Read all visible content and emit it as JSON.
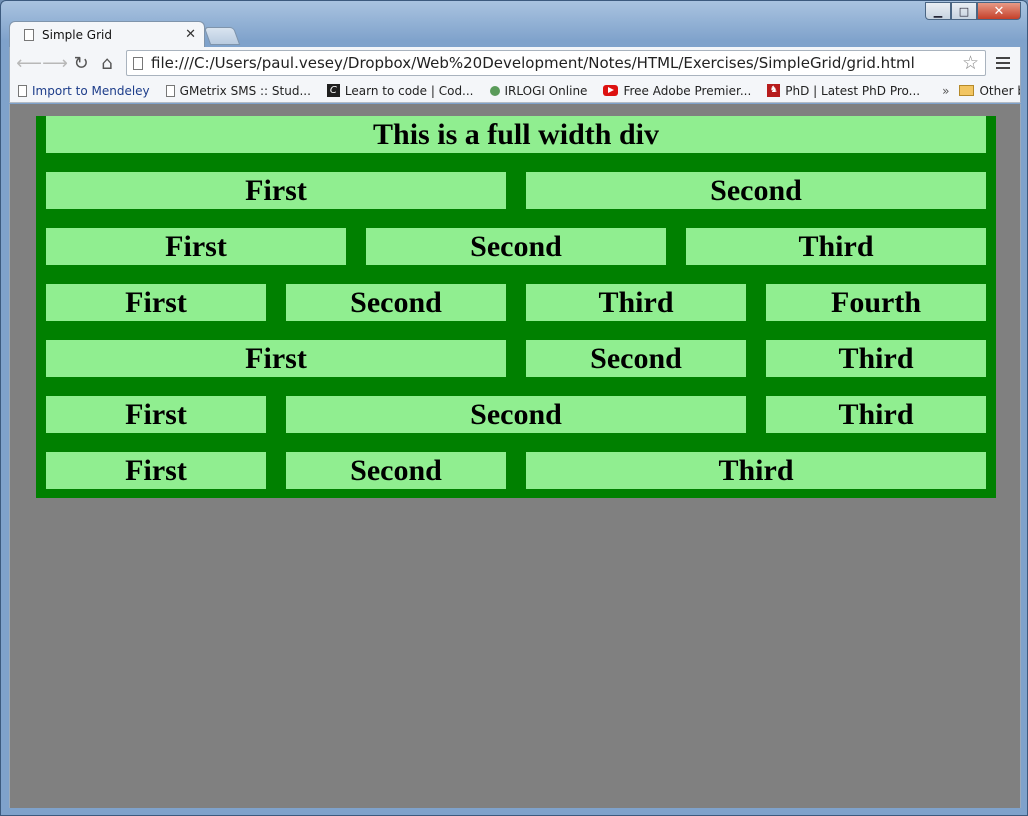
{
  "browser": {
    "tab_title": "Simple Grid",
    "url": "file:///C:/Users/paul.vesey/Dropbox/Web%20Development/Notes/HTML/Exercises/SimpleGrid/grid.html",
    "bookmarks": [
      {
        "label": "Import to Mendeley",
        "icon": "page-icon"
      },
      {
        "label": "GMetrix SMS :: Stud...",
        "icon": "page-icon"
      },
      {
        "label": "Learn to code | Cod...",
        "icon": "codecademy-icon"
      },
      {
        "label": "IRLOGI Online",
        "icon": "irlogi-icon"
      },
      {
        "label": "Free Adobe Premier...",
        "icon": "youtube-icon"
      },
      {
        "label": "PhD | Latest PhD Pro...",
        "icon": "phd-icon"
      }
    ],
    "bookmarks_overflow": "»",
    "other_bookmarks": "Other bookmarks"
  },
  "page": {
    "background": "#808080",
    "container_color": "#008000",
    "cell_color": "#90ee90",
    "rows": [
      {
        "cells": [
          {
            "label": "This is a full width div"
          }
        ]
      },
      {
        "cells": [
          {
            "label": "First"
          },
          {
            "label": "Second"
          }
        ]
      },
      {
        "cells": [
          {
            "label": "First"
          },
          {
            "label": "Second"
          },
          {
            "label": "Third"
          }
        ]
      },
      {
        "cells": [
          {
            "label": "First"
          },
          {
            "label": "Second"
          },
          {
            "label": "Third"
          },
          {
            "label": "Fourth"
          }
        ]
      },
      {
        "cells": [
          {
            "label": "First"
          },
          {
            "label": "Second"
          },
          {
            "label": "Third"
          }
        ]
      },
      {
        "cells": [
          {
            "label": "First"
          },
          {
            "label": "Second"
          },
          {
            "label": "Third"
          }
        ]
      },
      {
        "cells": [
          {
            "label": "First"
          },
          {
            "label": "Second"
          },
          {
            "label": "Third"
          }
        ]
      }
    ]
  }
}
